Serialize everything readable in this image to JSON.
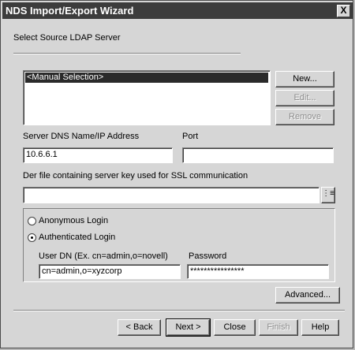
{
  "window": {
    "title": "NDS Import/Export Wizard",
    "close_glyph": "X"
  },
  "step": {
    "heading": "Select Source LDAP Server"
  },
  "server_list": {
    "items": [
      "<Manual Selection>"
    ],
    "selected_index": 0,
    "new_label": "New...",
    "edit_label": "Edit...",
    "remove_label": "Remove"
  },
  "server": {
    "dns_label": "Server DNS Name/IP Address",
    "dns_value": "10.6.6.1",
    "port_label": "Port",
    "port_value": ""
  },
  "ssl": {
    "label": "Der file containing server key used for SSL communication",
    "value": "",
    "browse_icon": "browse-icon"
  },
  "login": {
    "anonymous_label": "Anonymous Login",
    "authenticated_label": "Authenticated Login",
    "selected": "authenticated",
    "user_dn_label": "User DN (Ex. cn=admin,o=novell)",
    "user_dn_value": "cn=admin,o=xyzcorp",
    "password_label": "Password",
    "password_value": "****************"
  },
  "advanced_label": "Advanced...",
  "footer": {
    "back_label": "< Back",
    "next_label": "Next >",
    "close_label": "Close",
    "finish_label": "Finish",
    "help_label": "Help"
  }
}
